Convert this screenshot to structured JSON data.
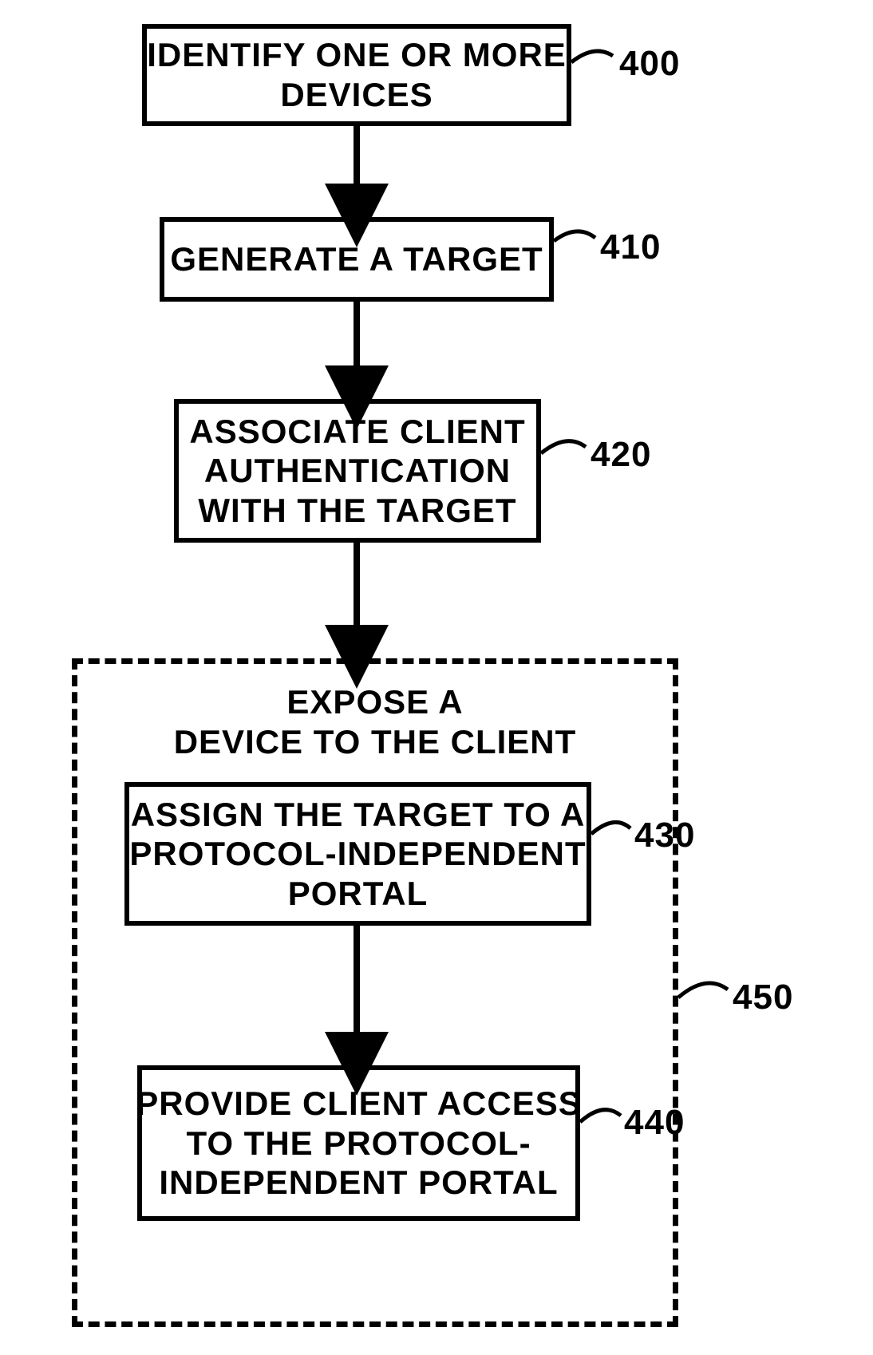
{
  "steps": {
    "s400": {
      "text": "IDENTIFY ONE OR MORE\nDEVICES",
      "ref": "400"
    },
    "s410": {
      "text": "GENERATE A TARGET",
      "ref": "410"
    },
    "s420": {
      "text": "ASSOCIATE CLIENT\nAUTHENTICATION\nWITH THE TARGET",
      "ref": "420"
    },
    "s430": {
      "text": "ASSIGN THE TARGET TO A\nPROTOCOL-INDEPENDENT\nPORTAL",
      "ref": "430"
    },
    "s440": {
      "text": "PROVIDE CLIENT ACCESS\nTO THE PROTOCOL-\nINDEPENDENT PORTAL",
      "ref": "440"
    }
  },
  "group": {
    "title": "EXPOSE A\nDEVICE TO THE CLIENT",
    "ref": "450"
  }
}
